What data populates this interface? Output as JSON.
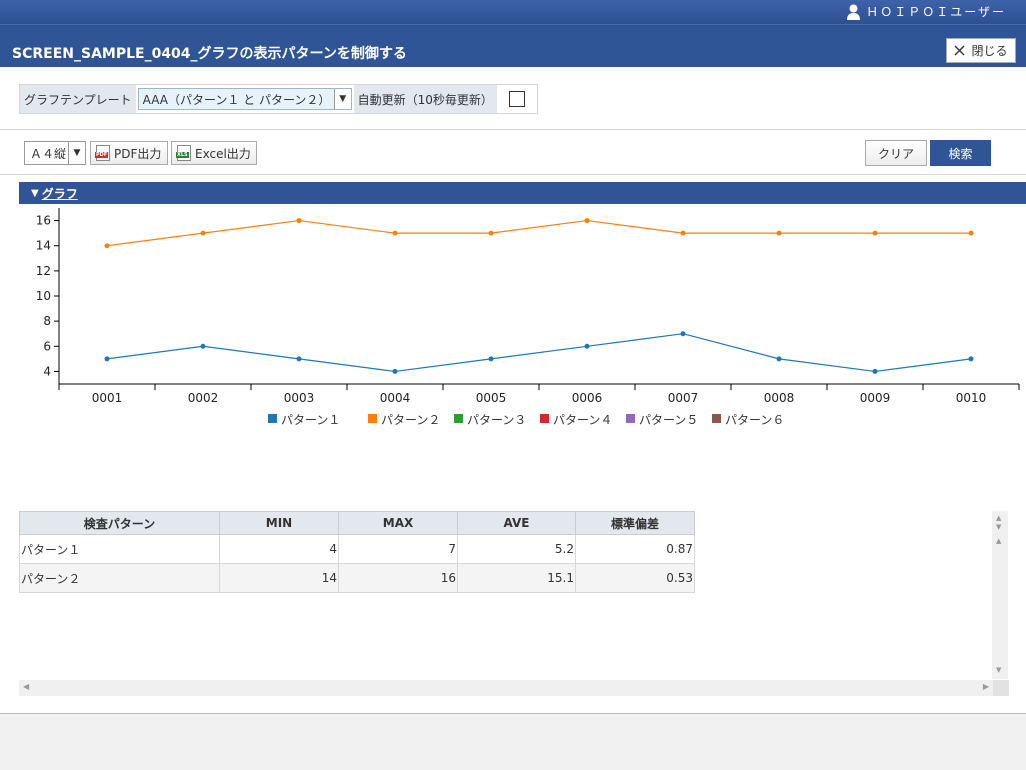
{
  "header": {
    "user_label": "ＨＯＩＰＯＩユーザー",
    "title": "SCREEN_SAMPLE_0404_グラフの表示パターンを制御する",
    "close_label": "閉じる"
  },
  "conditions": {
    "template_label": "グラフテンプレート",
    "template_value": "AAA（パターン１ と パターン２）",
    "auto_refresh_label": "自動更新（10秒毎更新）",
    "auto_refresh_checked": false
  },
  "toolbar": {
    "paper_value": "Ａ４縦",
    "pdf_label": "PDF出力",
    "excel_label": "Excel出力",
    "clear_label": "クリア",
    "search_label": "検索"
  },
  "section": {
    "title": "グラフ"
  },
  "chart_data": {
    "type": "line",
    "x": [
      "0001",
      "0002",
      "0003",
      "0004",
      "0005",
      "0006",
      "0007",
      "0008",
      "0009",
      "0010"
    ],
    "ylim": [
      3,
      17
    ],
    "yticks": [
      4,
      6,
      8,
      10,
      12,
      14,
      16
    ],
    "grid": false,
    "legend_position": "bottom",
    "series": [
      {
        "name": "パターン１",
        "color": "#1f77b4",
        "values": [
          5,
          6,
          5,
          4,
          5,
          6,
          7,
          5,
          4,
          5
        ]
      },
      {
        "name": "パターン２",
        "color": "#ff7f0e",
        "values": [
          14,
          15,
          16,
          15,
          15,
          16,
          15,
          15,
          15,
          15
        ]
      },
      {
        "name": "パターン３",
        "color": "#2ca02c",
        "values": []
      },
      {
        "name": "パターン４",
        "color": "#d62728",
        "values": []
      },
      {
        "name": "パターン５",
        "color": "#9467bd",
        "values": []
      },
      {
        "name": "パターン６",
        "color": "#8c564b",
        "values": []
      }
    ]
  },
  "stats": {
    "headers": [
      "検査パターン",
      "MIN",
      "MAX",
      "AVE",
      "標準偏差"
    ],
    "rows": [
      [
        "パターン１",
        "4",
        "7",
        "5.2",
        "0.87"
      ],
      [
        "パターン２",
        "14",
        "16",
        "15.1",
        "0.53"
      ]
    ]
  }
}
